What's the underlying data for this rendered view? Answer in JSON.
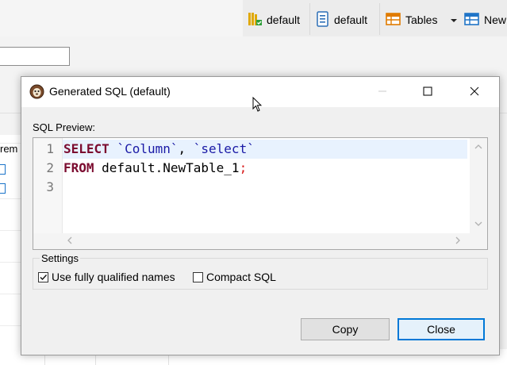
{
  "toolbar": {
    "items": [
      {
        "label": "default",
        "icon": "database-icon"
      },
      {
        "label": "default",
        "icon": "schema-icon"
      },
      {
        "label": "Tables",
        "icon": "tables-icon"
      },
      {
        "label": "New",
        "icon": "new-table-icon"
      }
    ],
    "dropdown_icon": "dropdown-arrow-icon"
  },
  "background": {
    "column_header_fragment": "rem"
  },
  "dialog": {
    "title": "Generated SQL (default)",
    "sql_preview_label": "SQL Preview:",
    "editor": {
      "line_numbers": [
        "1",
        "2",
        "3"
      ],
      "lines": [
        [
          {
            "text": "SELECT",
            "kind": "kw"
          },
          {
            "text": " ",
            "kind": "punct"
          },
          {
            "text": "`Column`",
            "kind": "ident"
          },
          {
            "text": ", ",
            "kind": "punct"
          },
          {
            "text": "`select`",
            "kind": "ident"
          }
        ],
        [
          {
            "text": "FROM",
            "kind": "kw"
          },
          {
            "text": " default.NewTable_1",
            "kind": "punct"
          },
          {
            "text": ";",
            "kind": "semi"
          }
        ],
        []
      ]
    },
    "settings": {
      "label": "Settings",
      "use_fully_qualified_names": {
        "label": "Use fully qualified names",
        "checked": true
      },
      "compact_sql": {
        "label": "Compact SQL",
        "checked": false
      }
    },
    "buttons": {
      "copy": "Copy",
      "close": "Close"
    }
  },
  "colors": {
    "keyword": "#7b0b2f",
    "identifier": "#1a1aa6",
    "semicolon": "#d81b1b",
    "current_line": "#e8f2fe",
    "default_button_border": "#0078d7"
  }
}
